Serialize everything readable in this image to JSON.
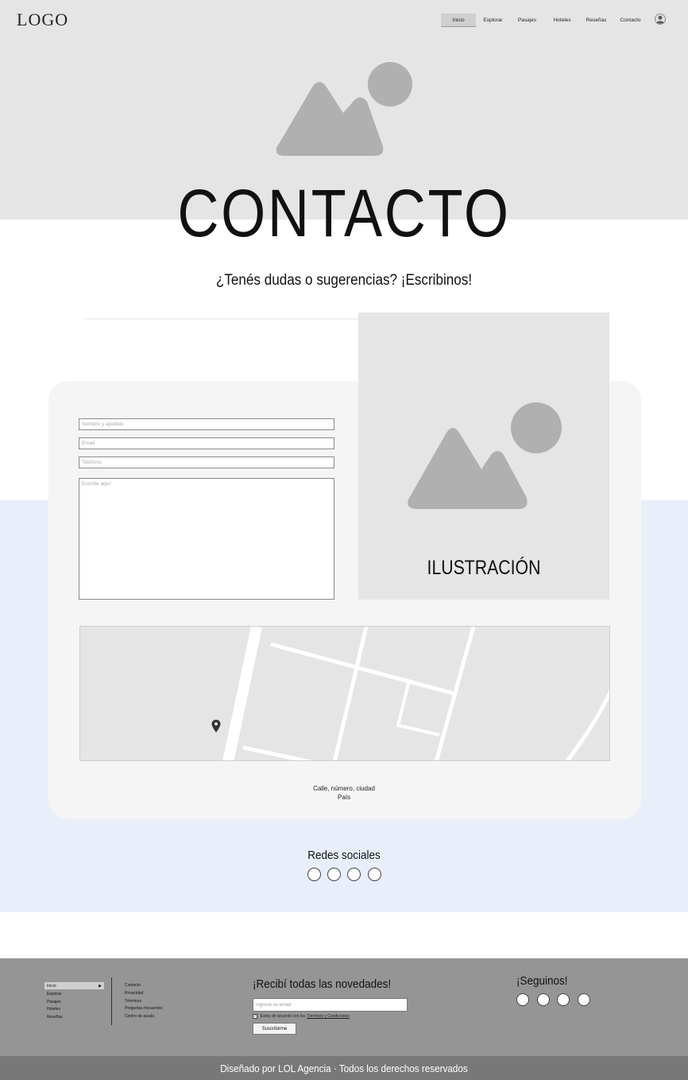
{
  "header": {
    "logo": "LOGO",
    "nav": [
      {
        "label": "Inicio",
        "active": true
      },
      {
        "label": "Explorar",
        "active": false
      },
      {
        "label": "Pasajes",
        "active": false
      },
      {
        "label": "Hoteles",
        "active": false
      },
      {
        "label": "Reseñas",
        "active": false
      },
      {
        "label": "Contacto",
        "active": false
      }
    ],
    "user_icon": "user-avatar-icon"
  },
  "hero": {
    "image_icon": "image-placeholder-icon",
    "title": "CONTACTO",
    "subtitle": "¿Tenés dudas o sugerencias? ¡Escribinos!"
  },
  "form": {
    "name_placeholder": "Nombre y apellido",
    "email_placeholder": "Email",
    "phone_placeholder": "Teléfono",
    "message_placeholder": "Escribe aquí"
  },
  "illustration": {
    "label": "ILUSTRACIÓN",
    "image_icon": "image-placeholder-icon"
  },
  "map": {
    "pin_icon": "map-pin-icon"
  },
  "address": {
    "line1": "Calle, número, ciudad",
    "line2": "País"
  },
  "social": {
    "title": "Redes sociales",
    "count": 4
  },
  "footer": {
    "nav": [
      {
        "label": "Inicio",
        "active": true
      },
      {
        "label": "Explorar",
        "active": false
      },
      {
        "label": "Pasajes",
        "active": false
      },
      {
        "label": "Hoteles",
        "active": false
      },
      {
        "label": "Reseñas",
        "active": false
      }
    ],
    "links": [
      "Contacto",
      "Privacidad",
      "Términos",
      "Preguntas frecuentes",
      "Centro de ayuda"
    ],
    "newsletter": {
      "title": "¡Recibí todas las novedades!",
      "email_placeholder": "Ingrese su email",
      "terms_prefix": "Estoy de acuerdo con los",
      "terms_link": "Términos y Condiciones",
      "checked": true,
      "button": "Suscribirme"
    },
    "follow_title": "¡Seguinos!",
    "follow_count": 4,
    "copyright": "Diseñado por LOL Agencia · Todos los derechos reservados"
  },
  "colors": {
    "hero_bg": "#e5e5e5",
    "card_bg": "#f5f5f5",
    "band_bg": "#e8eefa",
    "footer_bg": "#959595",
    "bottom_bar": "#787878",
    "placeholder_gray": "#b0b0b0"
  }
}
